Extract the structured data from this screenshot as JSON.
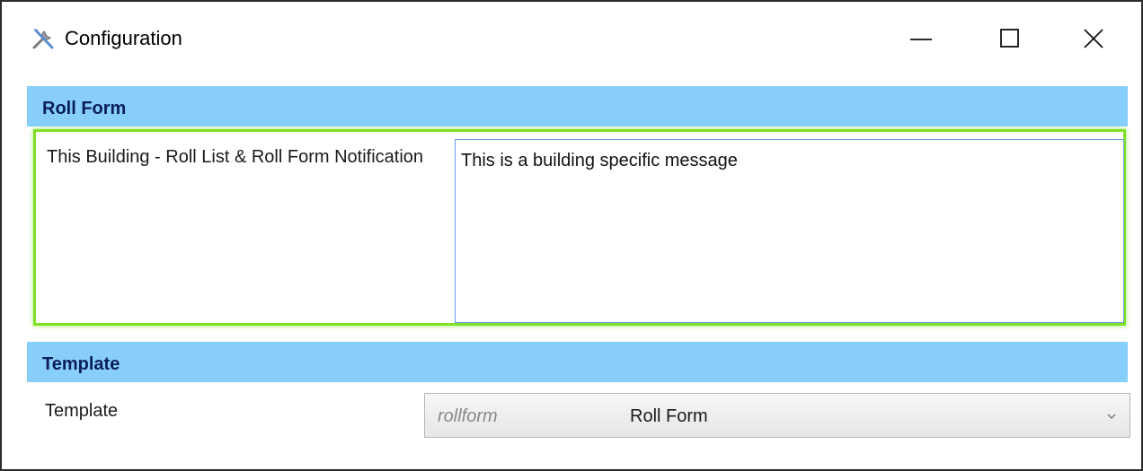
{
  "window": {
    "title": "Configuration",
    "icon": "tools-icon",
    "controls": [
      "minimize-icon",
      "maximize-icon",
      "close-icon"
    ]
  },
  "sections": {
    "roll_form": {
      "header": "Roll Form",
      "row": {
        "label": "This Building - Roll List & Roll Form Notification",
        "value": "This is a building specific message"
      }
    },
    "template": {
      "header": "Template",
      "row": {
        "label": "Template",
        "selected_code": "rollform",
        "selected_name": "Roll Form",
        "dropdown_icon": "chevron-down-icon"
      }
    }
  },
  "colors": {
    "section_header_bg": "#87cefa",
    "section_header_text": "#0b1d5c",
    "highlight_border": "#7fe126",
    "input_border": "#6b9be0"
  }
}
